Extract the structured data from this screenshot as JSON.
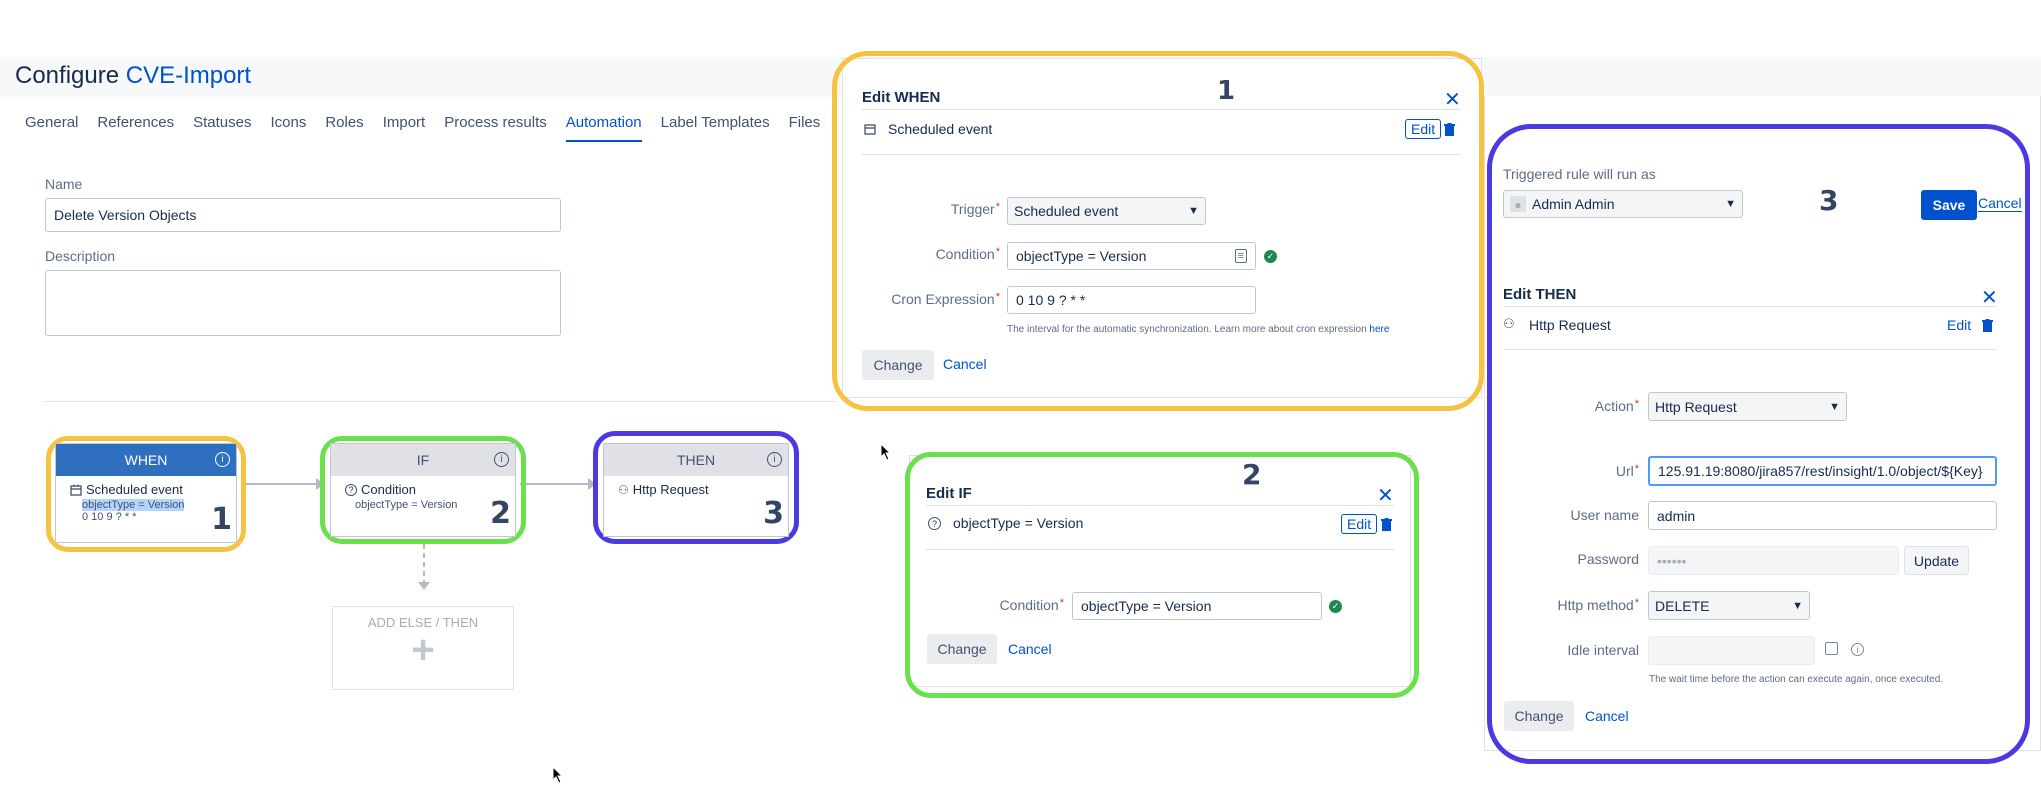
{
  "page": {
    "title_prefix": "Configure",
    "title_link": "CVE-Import",
    "tabs": [
      "General",
      "References",
      "Statuses",
      "Icons",
      "Roles",
      "Import",
      "Process results",
      "Automation",
      "Label Templates",
      "Files"
    ],
    "active_tab": "Automation"
  },
  "form": {
    "name_label": "Name",
    "name_value": "Delete Version Objects",
    "description_label": "Description",
    "description_value": ""
  },
  "workflow": {
    "when": {
      "title": "WHEN",
      "item": "Scheduled event",
      "sub1": "objectType = Version",
      "sub2": "0 10 9 ? * *",
      "marker": "1"
    },
    "if": {
      "title": "IF",
      "item": "Condition",
      "sub1": "objectType = Version",
      "marker": "2"
    },
    "then": {
      "title": "THEN",
      "item": "Http Request",
      "marker": "3"
    },
    "add_else": {
      "label": "ADD ELSE / THEN",
      "plus": "+"
    }
  },
  "edit_when": {
    "marker": "1",
    "title": "Edit WHEN",
    "summary": "Scheduled event",
    "edit_label": "Edit",
    "trigger_label": "Trigger",
    "trigger_value": "Scheduled event",
    "condition_label": "Condition",
    "condition_value": "objectType = Version",
    "cron_label": "Cron Expression",
    "cron_value": "0 10 9 ? * *",
    "hint": "The interval for the automatic synchronization. Learn more about cron expression",
    "hint_link": "here",
    "change_label": "Change",
    "cancel_label": "Cancel"
  },
  "edit_if": {
    "marker": "2",
    "title": "Edit IF",
    "summary": "objectType = Version",
    "edit_label": "Edit",
    "condition_label": "Condition",
    "condition_value": "objectType = Version",
    "change_label": "Change",
    "cancel_label": "Cancel"
  },
  "edit_then": {
    "marker": "3",
    "run_as_label": "Triggered rule will run as",
    "run_as_user": "Admin Admin",
    "save_label": "Save",
    "cancel_top_label": "Cancel",
    "title": "Edit THEN",
    "summary": "Http Request",
    "edit_label": "Edit",
    "action_label": "Action",
    "action_value": "Http Request",
    "url_label": "Url",
    "url_value": "125.91.19:8080/jira857/rest/insight/1.0/object/${Key}",
    "username_label": "User name",
    "username_value": "admin",
    "password_label": "Password",
    "password_value": "••••••",
    "update_label": "Update",
    "method_label": "Http method",
    "method_value": "DELETE",
    "idle_label": "Idle interval",
    "idle_value": "",
    "idle_hint": "The wait time before the action can execute again, once executed.",
    "change_label": "Change",
    "cancel_label": "Cancel"
  },
  "colors": {
    "highlight_when": "#f5c242",
    "highlight_if": "#6be04f",
    "highlight_then": "#4a3ae0",
    "when_header": "#2f6fc0",
    "link": "#0052cc"
  }
}
